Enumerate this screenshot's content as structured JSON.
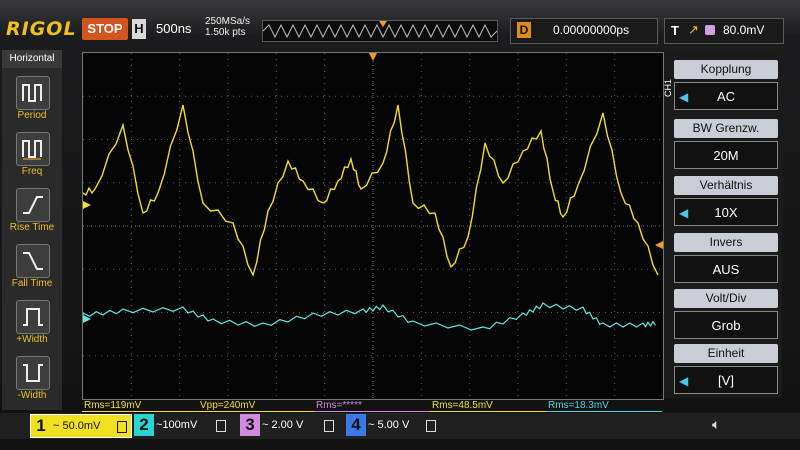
{
  "header": {
    "brand": "RIGOL",
    "run_state": "STOP",
    "timebase_key": "H",
    "timebase_scale": "500ns",
    "sample_rate": "250MSa/s",
    "memory_depth": "1.50k pts",
    "delay_key": "D",
    "delay_value": "0.00000000ps",
    "trigger_type": "T",
    "trigger_edge_icon": "rising-edge",
    "trigger_level": "80.0mV"
  },
  "left_menu": {
    "title": "Horizontal",
    "items": [
      {
        "label": "Period",
        "icon": "period-icon"
      },
      {
        "label": "Freq",
        "icon": "frequency-icon"
      },
      {
        "label": "Rise Time",
        "icon": "rise-time-icon"
      },
      {
        "label": "Fall Time",
        "icon": "fall-time-icon"
      },
      {
        "label": "+Width",
        "icon": "positive-width-icon"
      },
      {
        "label": "-Width",
        "icon": "negative-width-icon"
      }
    ]
  },
  "right_menu": {
    "channel_tag": "CH1",
    "items": [
      {
        "key": "Kopplung",
        "value": "AC",
        "arrow": true
      },
      {
        "key": "BW Grenzw.",
        "value": "20M",
        "arrow": false
      },
      {
        "key": "Verhältnis",
        "value": "10X",
        "arrow": true
      },
      {
        "key": "Invers",
        "value": "AUS",
        "arrow": false
      },
      {
        "key": "Volt/Div",
        "value": "Grob",
        "arrow": false
      },
      {
        "key": "Einheit",
        "value": "[V]",
        "arrow": true
      }
    ]
  },
  "measurements": [
    {
      "text": "Rms=119mV",
      "color": "#f0e020"
    },
    {
      "text": "Vpp=240mV",
      "color": "#f0e020"
    },
    {
      "text": "Rms=*****",
      "color": "#d08ae0"
    },
    {
      "text": "Rms=48.5mV",
      "color": "#f0e020"
    },
    {
      "text": "Rms=18.3mV",
      "color": "#4ed8e8"
    }
  ],
  "channels": [
    {
      "num": "1",
      "coupling": "~",
      "scale": "50.0mV",
      "color": "#f0e020",
      "active": true
    },
    {
      "num": "2",
      "coupling": "~",
      "scale": "100mV",
      "color": "#2ad4d0",
      "active": false
    },
    {
      "num": "3",
      "coupling": "~",
      "scale": "2.00 V",
      "color": "#d08ae0",
      "active": false
    },
    {
      "num": "4",
      "coupling": "~",
      "scale": "5.00 V",
      "color": "#3a7ae8",
      "active": false
    }
  ],
  "colors": {
    "ch1": "#f0e020",
    "ch2": "#5de8e0",
    "trigger": "#f0a020",
    "accent": "#f0c020"
  }
}
